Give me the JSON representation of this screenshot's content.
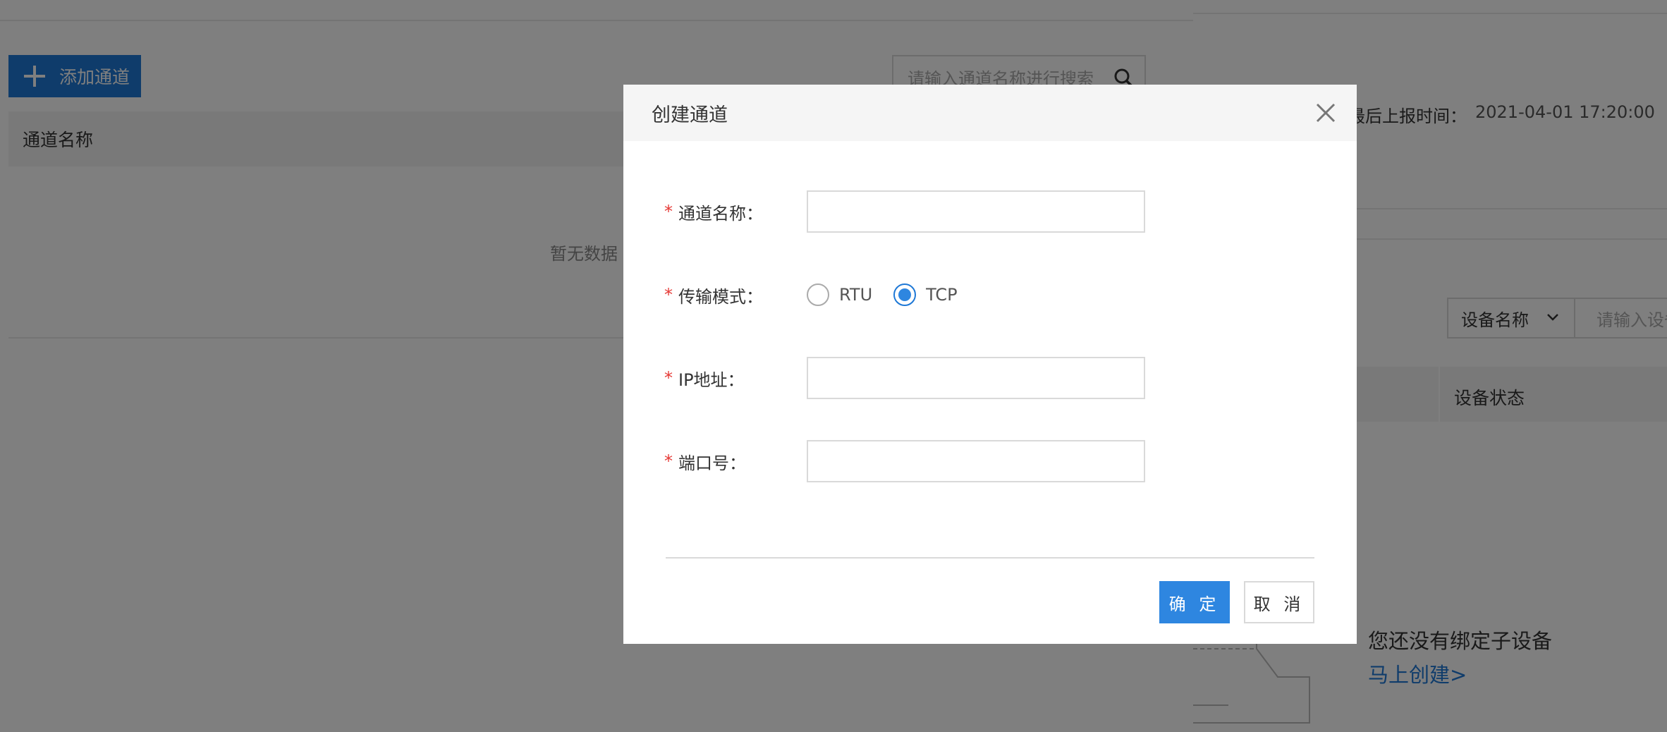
{
  "left": {
    "add_button_label": "添加通道",
    "search_placeholder": "请输入通道名称进行搜索",
    "table_header": "通道名称",
    "empty_text": "暂无数据"
  },
  "right": {
    "report_label": "最后上报时间：",
    "report_value": "2021-04-01 17:20:00",
    "device_select_label": "设备名称",
    "device_input_placeholder": "请输入设备",
    "status_column": "设备状态",
    "no_device_text": "您还没有绑定子设备",
    "create_link": "马上创建>"
  },
  "modal": {
    "title": "创建通道",
    "fields": {
      "channel_name_label": "通道名称：",
      "transport_label": "传输模式：",
      "ip_label": "IP地址：",
      "port_label": "端口号："
    },
    "transport_options": [
      "RTU",
      "TCP"
    ],
    "transport_selected": "TCP",
    "ok_label": "确 定",
    "cancel_label": "取 消"
  },
  "colors": {
    "primary": "#2e86e0",
    "required": "#e53935",
    "overlay": "rgba(0,0,0,0.5)"
  }
}
